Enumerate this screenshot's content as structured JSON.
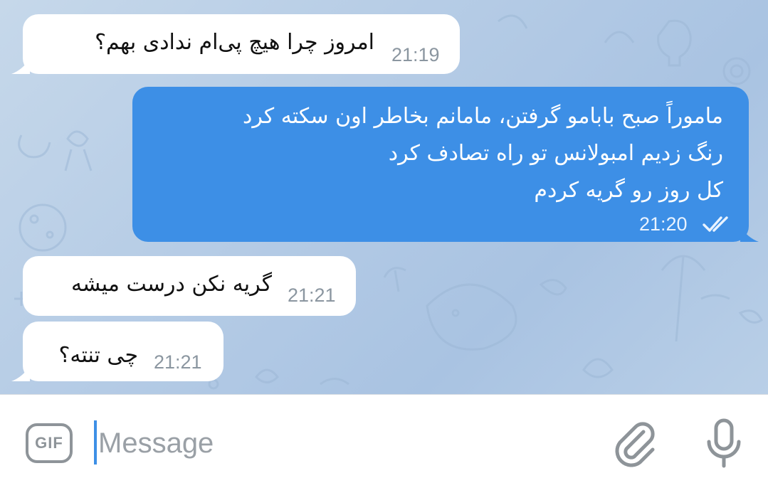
{
  "messages": [
    {
      "direction": "incoming",
      "text": "امروز چرا هیچ پی‌ام ندادی بهم؟",
      "time": "21:19"
    },
    {
      "direction": "outgoing",
      "lines": [
        "ماموراً صبح بابامو گرفتن، مامانم بخاطر اون سکته کرد",
        "رنگ زدیم امبولانس تو راه تصادف کرد",
        "کل روز رو گریه کردم"
      ],
      "time": "21:20",
      "status_icon": "double-check-icon"
    },
    {
      "direction": "incoming",
      "text": "گریه نکن درست میشه",
      "time": "21:21"
    },
    {
      "direction": "incoming",
      "text": "چی تنته؟",
      "time": "21:21"
    }
  ],
  "composer": {
    "gif_label": "GIF",
    "placeholder": "Message",
    "attach_icon": "paperclip-icon",
    "mic_icon": "microphone-icon"
  },
  "colors": {
    "outgoing_bubble": "#3d8fe6",
    "incoming_bubble": "#ffffff",
    "wallpaper": "#b7cde6",
    "accent": "#3d8fe6"
  }
}
